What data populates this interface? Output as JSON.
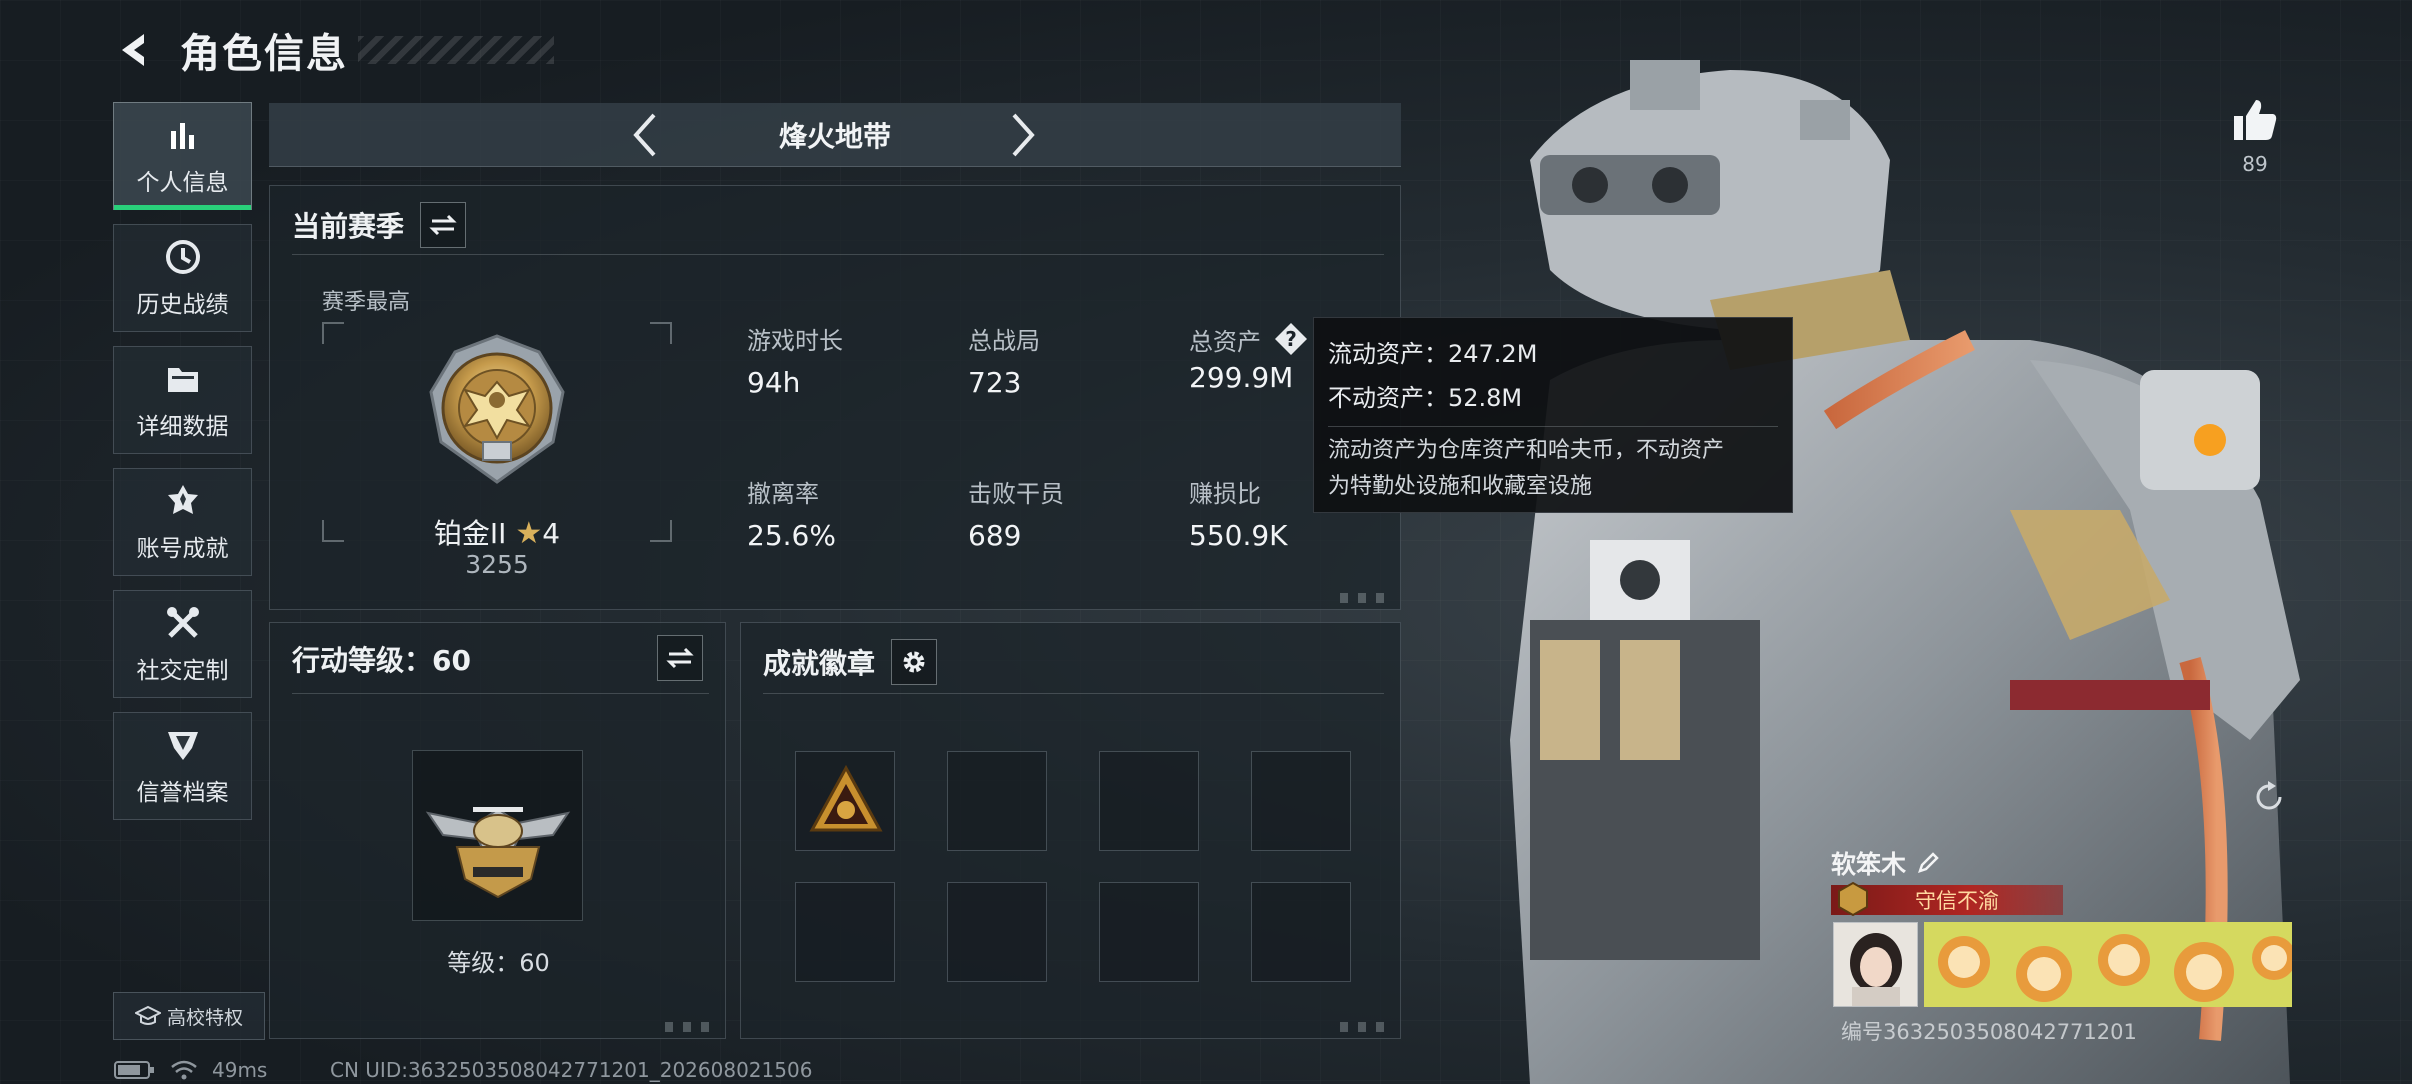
{
  "header": {
    "title": "角色信息"
  },
  "sidebar": {
    "items": [
      {
        "label": "个人信息",
        "icon": "bar-chart-icon",
        "active": true
      },
      {
        "label": "历史战绩",
        "icon": "history-clock-icon",
        "active": false
      },
      {
        "label": "详细数据",
        "icon": "folder-icon",
        "active": false
      },
      {
        "label": "账号成就",
        "icon": "achievement-icon",
        "active": false
      },
      {
        "label": "社交定制",
        "icon": "tools-icon",
        "active": false
      },
      {
        "label": "信誉档案",
        "icon": "credit-icon",
        "active": false
      }
    ],
    "campus_label": "高校特权"
  },
  "mode": {
    "name": "烽火地带"
  },
  "season": {
    "title": "当前赛季",
    "best_label": "赛季最高",
    "rank_name": "铂金II",
    "rank_stars": "4",
    "rank_score": "3255",
    "stats": [
      {
        "label": "游戏时长",
        "value": "94h"
      },
      {
        "label": "总战局",
        "value": "723"
      },
      {
        "label": "总资产",
        "value": "299.9M"
      },
      {
        "label": "撤离率",
        "value": "25.6%"
      },
      {
        "label": "击败干员",
        "value": "689"
      },
      {
        "label": "赚损比",
        "value": "550.9K"
      }
    ]
  },
  "tooltip": {
    "liquid": "流动资产：247.2M",
    "fixed": "不动资产：52.8M",
    "note_line1": "流动资产为仓库资产和哈夫币，不动资产",
    "note_line2": "为特勤处设施和收藏室设施"
  },
  "action_level": {
    "title": "行动等级：60",
    "level_text": "等级：60"
  },
  "achievements": {
    "title": "成就徽章",
    "slots_filled": 1,
    "slots_total": 8
  },
  "like": {
    "count": "89"
  },
  "profile": {
    "name": "软笨木",
    "tag": "守信不渝",
    "uid_text": "编号3632503508042771201"
  },
  "status": {
    "ping": "49ms",
    "cn_uid": "CN UID:3632503508042771201_202608021506"
  },
  "colors": {
    "accent_green": "#29d07a",
    "tag_red": "#b02622",
    "tooltip_bg": "#0e1012"
  }
}
